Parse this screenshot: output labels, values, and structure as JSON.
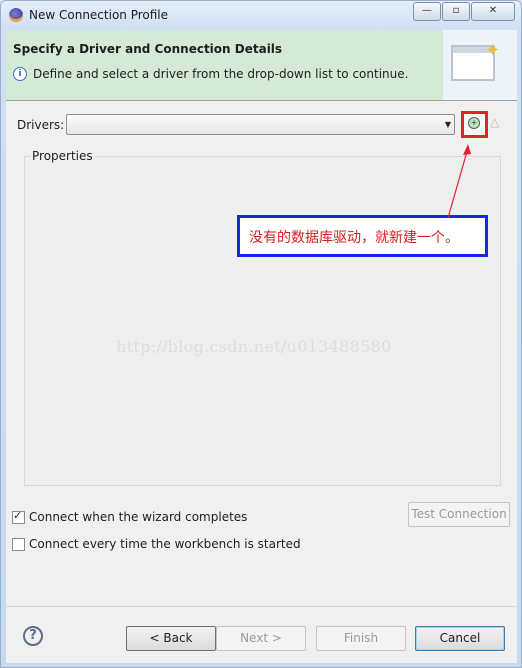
{
  "window": {
    "title": "New Connection Profile",
    "controls": {
      "minimize": "—",
      "maximize": "▫",
      "close": "✕"
    }
  },
  "header": {
    "title": "Specify a Driver and Connection Details",
    "message": "Define and select a driver from the drop-down list to continue.",
    "info_icon": "i"
  },
  "drivers": {
    "label": "Drivers:",
    "selected": ""
  },
  "properties": {
    "label": "Properties"
  },
  "annotation": {
    "text": "没有的数据库驱动，就新建一个。"
  },
  "watermark": "http://blog.csdn.net/u013488580",
  "options": {
    "connect_when_completes": {
      "label": "Connect when the wizard completes",
      "checked": true
    },
    "connect_every_time": {
      "label": "Connect every time the workbench is started",
      "checked": false
    }
  },
  "test_connection_label": "Test Connection",
  "footer": {
    "help": "?",
    "back": "< Back",
    "next": "Next >",
    "finish": "Finish",
    "cancel": "Cancel"
  },
  "colors": {
    "header_bg": "#d4ead6",
    "annotation_border": "#1626e6",
    "annotation_text": "#d4201f",
    "highlight_box": "#e8202a"
  }
}
